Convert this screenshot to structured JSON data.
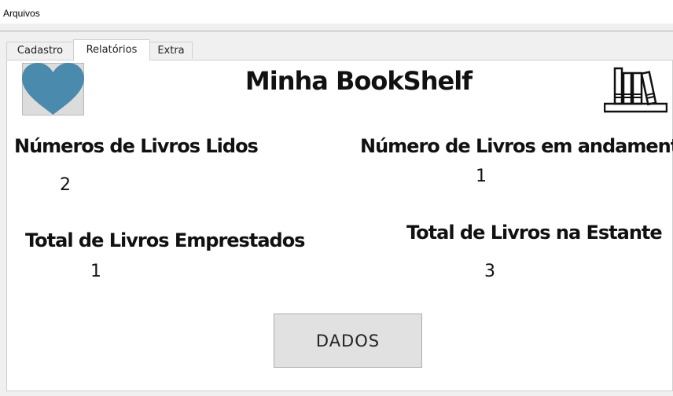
{
  "menu": {
    "items": [
      {
        "label": "Arquivos"
      }
    ]
  },
  "tabs": [
    {
      "label": "Cadastro",
      "active": false
    },
    {
      "label": "Relatórios",
      "active": true
    },
    {
      "label": "Extra",
      "active": false
    }
  ],
  "report": {
    "title": "Minha BookShelf",
    "read_label": "Números de Livros Lidos",
    "read_value": "2",
    "in_progress_label": "Número de Livros em andamento",
    "in_progress_value": "1",
    "lent_label": "Total de Livros Emprestados",
    "lent_value": "1",
    "shelf_label": "Total de Livros na Estante",
    "shelf_value": "3",
    "data_button": "DADOS"
  },
  "icons": {
    "heart": "heart-icon",
    "bookshelf": "bookshelf-icon"
  },
  "colors": {
    "heart": "#4a8aad"
  }
}
